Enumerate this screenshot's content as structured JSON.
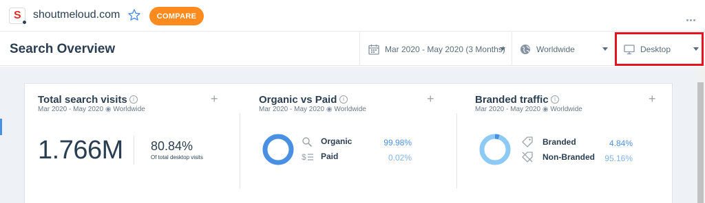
{
  "topbar": {
    "favicon_letter": "S",
    "domain": "shoutmeloud.com",
    "star_icon": "star-outline-icon",
    "compare_label": "COMPARE",
    "more_icon": "more-dots-icon"
  },
  "header": {
    "title": "Search Overview",
    "filters": {
      "date": "Mar 2020 - May 2020 (3 Months)",
      "country": "Worldwide",
      "device": "Desktop"
    }
  },
  "sections": {
    "total": {
      "title": "Total search visits",
      "sub_date": "Mar 2020 - May 2020",
      "sub_region": "Worldwide",
      "value": "1.766M",
      "pct": "80.84%",
      "pct_note": "Of total desktop visits"
    },
    "organic": {
      "title": "Organic vs Paid",
      "sub_date": "Mar 2020 - May 2020",
      "sub_region": "Worldwide",
      "rows": [
        {
          "label": "Organic",
          "value": "99.98%"
        },
        {
          "label": "Paid",
          "value": "0.02%"
        }
      ]
    },
    "branded": {
      "title": "Branded traffic",
      "sub_date": "Mar 2020 - May 2020",
      "sub_region": "Worldwide",
      "rows": [
        {
          "label": "Branded",
          "value": "4.84%"
        },
        {
          "label": "Non-Branded",
          "value": "95.16%"
        }
      ]
    }
  },
  "colors": {
    "accent": "#4a90e2",
    "accent_light": "#7fb3ec",
    "compare_button": "#ff8a1d",
    "highlight": "#e5141c"
  }
}
